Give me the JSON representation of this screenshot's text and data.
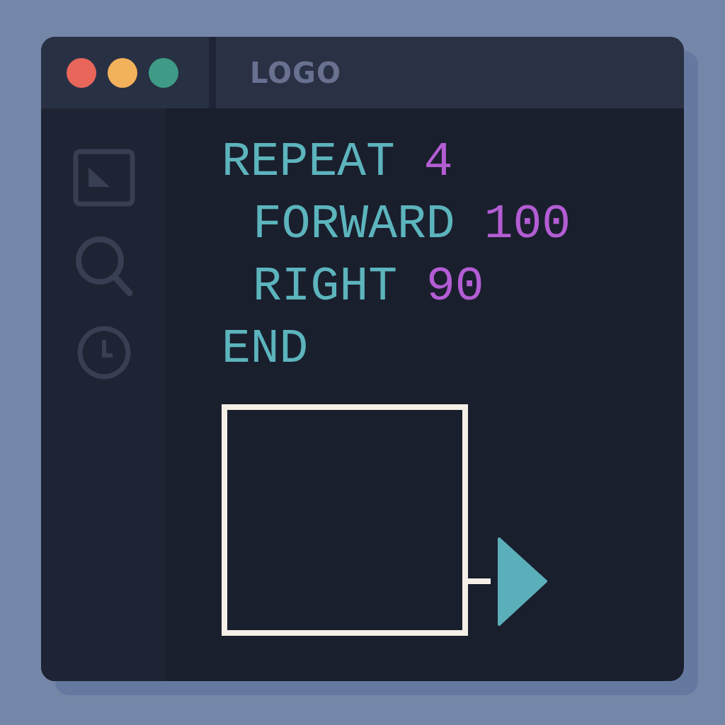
{
  "tab": {
    "label": "LOGO"
  },
  "code": [
    {
      "keyword": "REPEAT",
      "number": "4",
      "children": [
        {
          "keyword": "FORWARD",
          "number": "100"
        },
        {
          "keyword": "RIGHT",
          "number": "90"
        }
      ]
    },
    {
      "keyword": "END"
    }
  ]
}
